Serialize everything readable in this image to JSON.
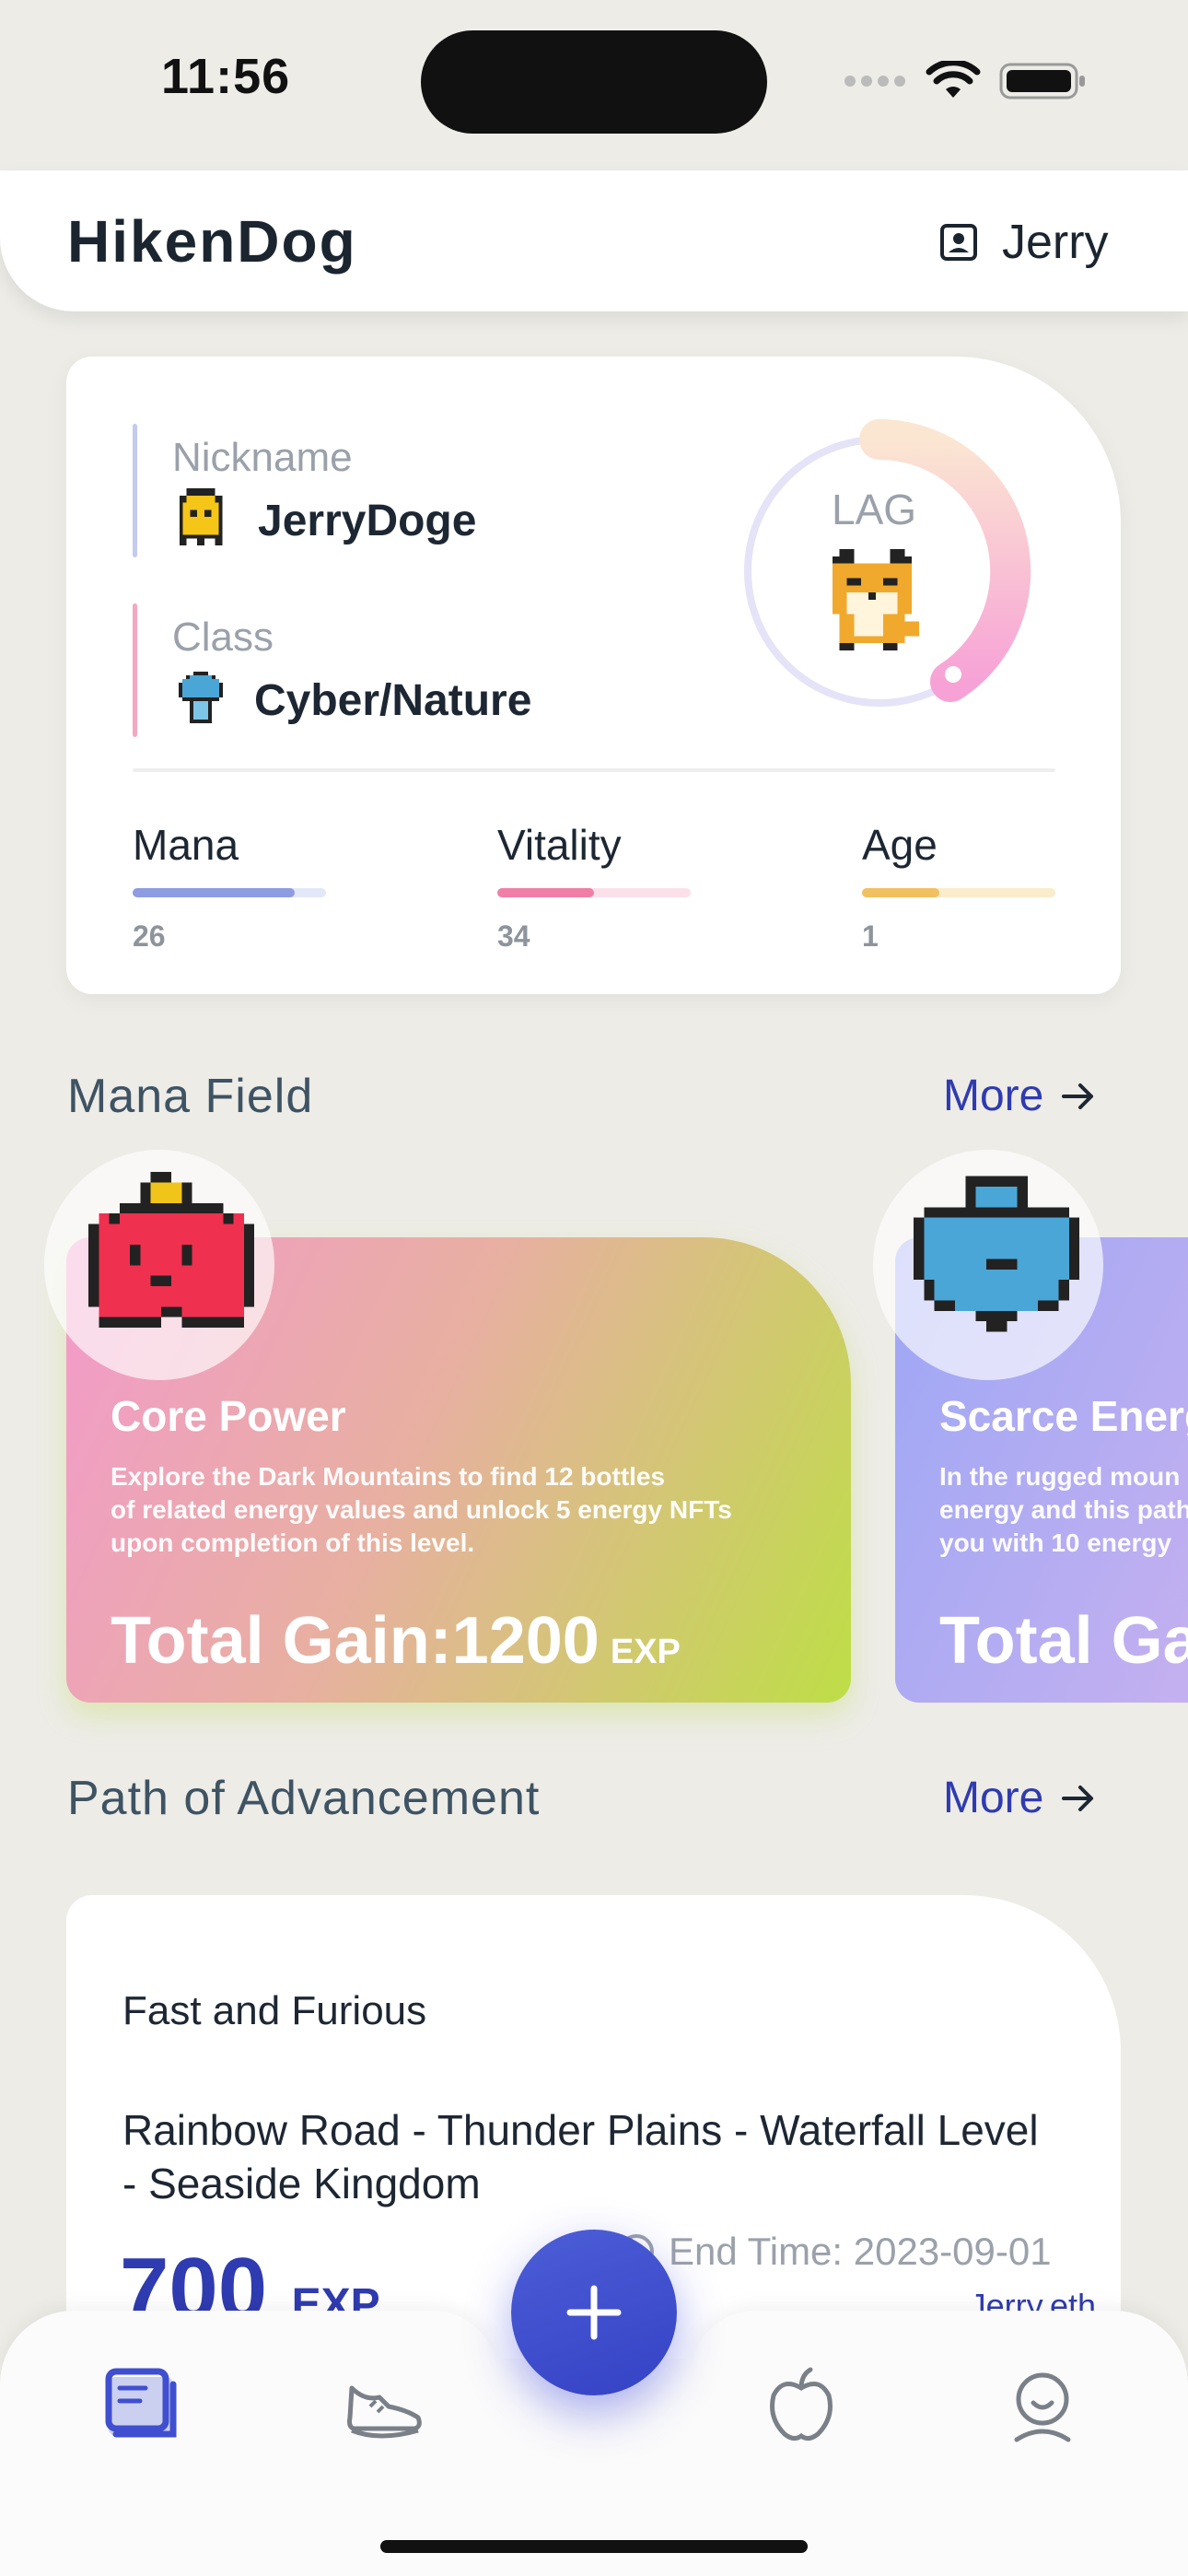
{
  "status": {
    "time": "11:56"
  },
  "header": {
    "title": "HikenDog",
    "user": "Jerry"
  },
  "profile": {
    "nickname_label": "Nickname",
    "nickname": "JerryDoge",
    "class_label": "Class",
    "class_value": "Cyber/Nature",
    "gauge_label": "LAG",
    "stats": [
      {
        "name": "Mana",
        "value": "26",
        "level": 0.84,
        "color": "#8e9ce2",
        "track": "#e3e8f8"
      },
      {
        "name": "Vitality",
        "value": "34",
        "level": 0.5,
        "color": "#ef7fa6",
        "track": "#fbe0ea"
      },
      {
        "name": "Age",
        "value": "1",
        "level": 0.4,
        "color": "#f1c060",
        "track": "#fbeccc"
      }
    ]
  },
  "mana_field": {
    "title": "Mana Field",
    "more": "More",
    "cards": [
      {
        "title": "Core Power",
        "desc_lines": [
          "Explore the Dark Mountains to find 12 bottles",
          "of related energy values and unlock 5 energy NFTs",
          "upon completion of this level."
        ],
        "gain": "Total Gain:1200",
        "unit": "EXP"
      },
      {
        "title": "Scarce Energy",
        "desc_lines": [
          "In the rugged moun",
          "energy and this path",
          "you with 10 energy"
        ],
        "gain": "Total Gain",
        "unit": ""
      }
    ]
  },
  "path": {
    "title": "Path of Advancement",
    "more": "More",
    "card_title": "Fast and Furious",
    "route_lines": [
      "Rainbow Road - Thunder Plains - Waterfall Level",
      "- Seaside Kingdom"
    ],
    "exp_value": "700",
    "exp_unit": "EXP",
    "end_time": "End Time: 2023-09-01",
    "owner": "Jerry.eth"
  },
  "colors": {
    "accent": "#2f3bb0",
    "fab": "#3f4fd0"
  }
}
